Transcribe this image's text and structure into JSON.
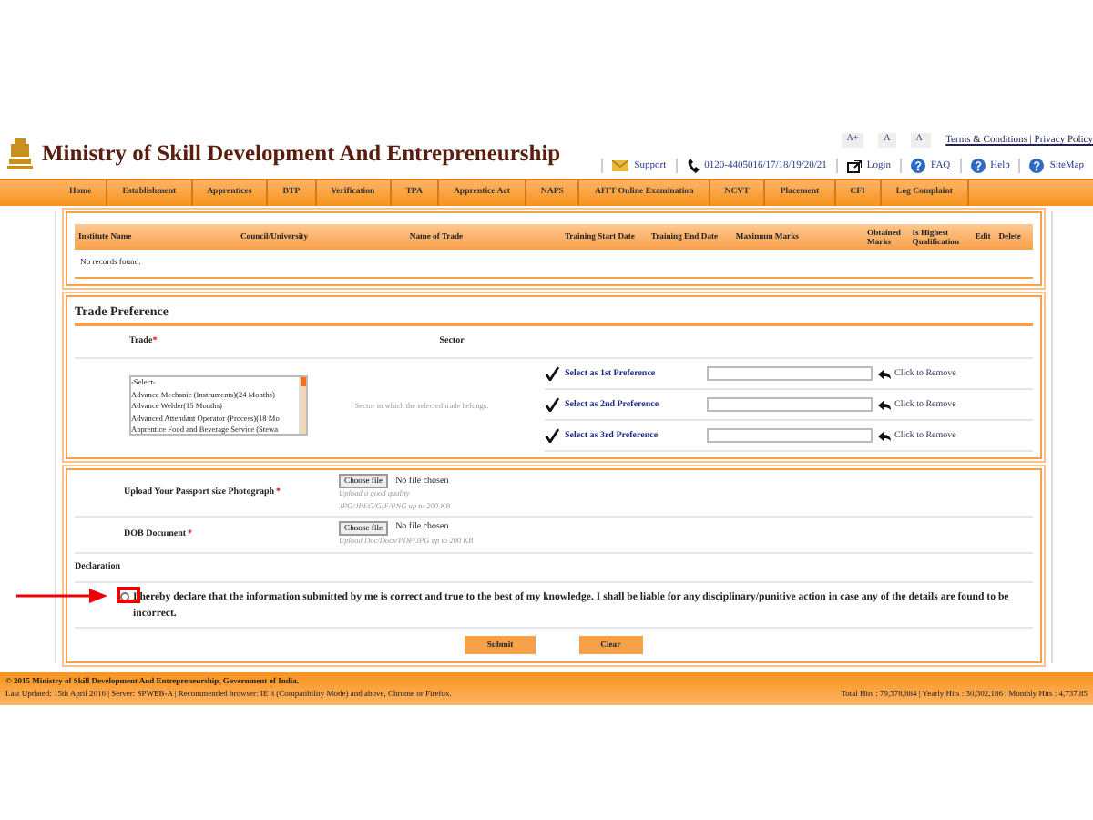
{
  "header": {
    "title": "Ministry of Skill Development And Entrepreneurship",
    "font_size_buttons": [
      "A+",
      "A",
      "A-"
    ],
    "top_links": "Terms & Conditions | Privacy Policy",
    "utility_links": [
      {
        "kind": "support",
        "label": "Support"
      },
      {
        "kind": "phone",
        "label": "0120-4405016/17/18/19/20/21"
      },
      {
        "kind": "login",
        "label": "Login"
      },
      {
        "kind": "help",
        "label": "FAQ"
      },
      {
        "kind": "help",
        "label": "Help"
      },
      {
        "kind": "help",
        "label": "SiteMap"
      }
    ]
  },
  "nav": [
    "Home",
    "Establishment",
    "Apprentices",
    "BTP",
    "Verification",
    "TPA",
    "Apprentice Act",
    "NAPS",
    "AITT Online Examination",
    "NCVT",
    "Placement",
    "CFI",
    "Log Complaint"
  ],
  "qualification_table": {
    "columns": [
      "Institute Name",
      "Council/University",
      "Name of Trade",
      "Training Start Date",
      "Training End Date",
      "Maximum Marks",
      "Obtained Marks",
      "Is Highest Qualification",
      "Edit",
      "Delete"
    ],
    "empty_message": "No records found."
  },
  "trade_preference": {
    "title": "Trade Preference",
    "trade_label": "Trade",
    "trade_required_mark": "*",
    "sector_label": "Sector",
    "trade_options": [
      "-Select-",
      "Advance Mechanic (Instruments)(24 Months)",
      "Advance Welder(15 Months)",
      "Advanced Attendant Operator (Process)(18 Mo",
      "Apprentice Food and Beverage Service (Stewa"
    ],
    "sector_hint": "Sector in which the selected trade belongs.",
    "preferences": [
      {
        "label": "Select as 1st Preference",
        "remove": "Click to Remove"
      },
      {
        "label": "Select as 2nd Preference",
        "remove": "Click to Remove"
      },
      {
        "label": "Select as 3rd Preference",
        "remove": "Click to Remove"
      }
    ]
  },
  "uploads": [
    {
      "label": "Upload Your Passport size Photograph",
      "required_mark": "*",
      "button": "Choose file",
      "status": "No file chosen",
      "hint": "Upload a good quality JPG/JPEG/GIF/PNG up to 200 KB"
    },
    {
      "label": "DOB Document",
      "required_mark": "*",
      "button": "Choose file",
      "status": "No file chosen",
      "hint": "Upload Doc/Docx/PDF/JPG up to 200 KB"
    }
  ],
  "declaration": {
    "title": "Declaration",
    "checked": false,
    "highlighted": true,
    "text": "I hereby declare that the information submitted by me is correct and true to the best of my knowledge. I shall be liable for any disciplinary/punitive action in case any of the details are found to be incorrect."
  },
  "buttons": [
    "Submit",
    "Clear"
  ],
  "footer": {
    "copyright": "© 2015 Ministry of Skill Development And Entrepreneurship, Government of India.",
    "last_updated": "Last Updated: 15th April 2016 | Server: SPWEB-A | Recommended browser: IE 8 (Compatibility Mode) and above, Chrome or Firefox.",
    "hits": "Total Hits : 79,378,884 | Yearly Hits : 30,302,186 | Monthly Hits : 4,737,85"
  }
}
